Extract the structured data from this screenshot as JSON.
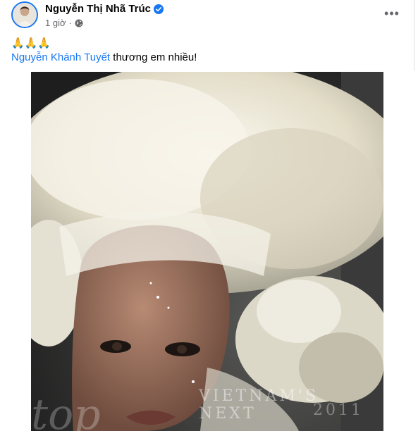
{
  "post": {
    "author": "Nguyễn Thị Nhã Trúc",
    "timestamp": "1 giờ",
    "privacy_icon": "globe-icon",
    "verified_icon": "verified-badge-icon",
    "more_label": "•••",
    "caption": {
      "emoji": "🙏🙏🙏",
      "mention": "Nguyễn Khánh Tuyết",
      "text": " thương em nhiều!"
    },
    "photo": {
      "watermark_text": "VIETNAM'S NEXT",
      "watermark_big": "top",
      "watermark_year": "2011"
    }
  },
  "colors": {
    "link": "#1877f2",
    "meta": "#65676b",
    "text": "#050505"
  }
}
